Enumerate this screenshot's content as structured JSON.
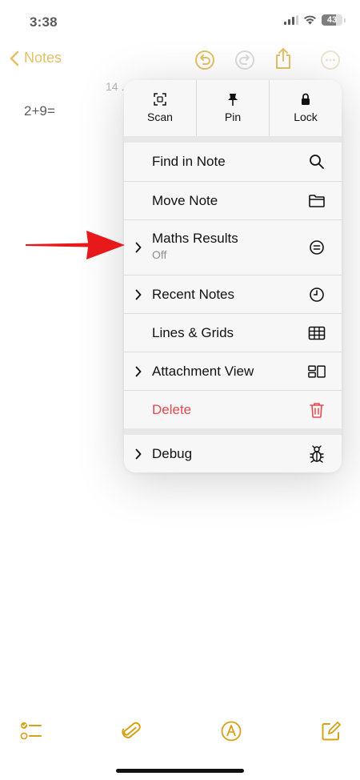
{
  "status_bar": {
    "time": "3:38",
    "battery": "43"
  },
  "nav": {
    "back_label": "Notes"
  },
  "note": {
    "date_partial": "14 .",
    "content": "2+9="
  },
  "menu": {
    "top_actions": [
      {
        "label": "Scan",
        "icon": "scan-icon"
      },
      {
        "label": "Pin",
        "icon": "pin-icon"
      },
      {
        "label": "Lock",
        "icon": "lock-icon"
      }
    ],
    "items": [
      {
        "label": "Find in Note",
        "icon": "search-icon"
      },
      {
        "label": "Move Note",
        "icon": "folder-icon"
      },
      {
        "label": "Maths Results",
        "sublabel": "Off",
        "icon": "equals-circle-icon",
        "chevron": true
      },
      {
        "label": "Recent Notes",
        "icon": "clock-icon",
        "chevron": true
      },
      {
        "label": "Lines & Grids",
        "icon": "grid-icon"
      },
      {
        "label": "Attachment View",
        "icon": "attachment-view-icon",
        "chevron": true
      },
      {
        "label": "Delete",
        "icon": "trash-icon",
        "destructive": true
      },
      {
        "label": "Debug",
        "icon": "bug-icon",
        "chevron": true
      }
    ]
  },
  "colors": {
    "accent": "#D6A017",
    "destructive": "#E5484D",
    "annotation_arrow": "#E8191B"
  }
}
